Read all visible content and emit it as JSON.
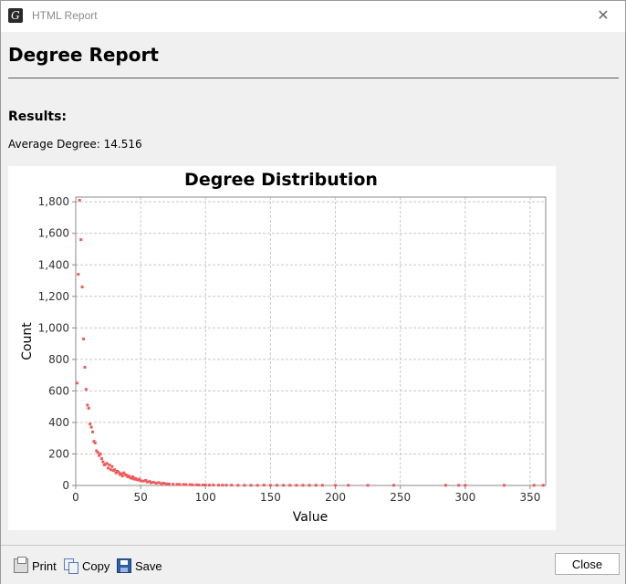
{
  "window": {
    "title": "HTML Report",
    "close_glyph": "✕"
  },
  "report": {
    "title": "Degree Report",
    "results_label": "Results:",
    "average_degree_label": "Average Degree:",
    "average_degree_value": "14.516"
  },
  "toolbar": {
    "print_label": "Print",
    "copy_label": "Copy",
    "save_label": "Save",
    "close_label": "Close"
  },
  "colors": {
    "point": "#f05a5a",
    "grid": "#c8c8c8"
  },
  "chart_data": {
    "type": "scatter",
    "title": "Degree Distribution",
    "xlabel": "Value",
    "ylabel": "Count",
    "xlim": [
      0,
      362
    ],
    "ylim": [
      0,
      1830
    ],
    "x_ticks": [
      0,
      50,
      100,
      150,
      200,
      250,
      300,
      350
    ],
    "y_ticks": [
      0,
      200,
      400,
      600,
      800,
      1000,
      1200,
      1400,
      1600,
      1800
    ],
    "y_tick_labels": [
      "0",
      "200",
      "400",
      "600",
      "800",
      "1,000",
      "1,200",
      "1,400",
      "1,600",
      "1,800"
    ],
    "grid": true,
    "legend": "none",
    "points": [
      [
        1,
        650
      ],
      [
        2,
        1340
      ],
      [
        3,
        1810
      ],
      [
        4,
        1560
      ],
      [
        5,
        1260
      ],
      [
        6,
        930
      ],
      [
        7,
        750
      ],
      [
        8,
        610
      ],
      [
        9,
        510
      ],
      [
        10,
        490
      ],
      [
        11,
        390
      ],
      [
        12,
        370
      ],
      [
        13,
        340
      ],
      [
        14,
        280
      ],
      [
        15,
        270
      ],
      [
        16,
        220
      ],
      [
        17,
        210
      ],
      [
        18,
        190
      ],
      [
        19,
        200
      ],
      [
        20,
        170
      ],
      [
        21,
        150
      ],
      [
        22,
        130
      ],
      [
        23,
        135
      ],
      [
        24,
        140
      ],
      [
        25,
        110
      ],
      [
        26,
        130
      ],
      [
        27,
        100
      ],
      [
        28,
        120
      ],
      [
        29,
        95
      ],
      [
        30,
        100
      ],
      [
        31,
        80
      ],
      [
        32,
        90
      ],
      [
        33,
        85
      ],
      [
        34,
        70
      ],
      [
        35,
        75
      ],
      [
        36,
        60
      ],
      [
        37,
        80
      ],
      [
        38,
        70
      ],
      [
        39,
        65
      ],
      [
        40,
        55
      ],
      [
        41,
        60
      ],
      [
        42,
        50
      ],
      [
        43,
        45
      ],
      [
        44,
        55
      ],
      [
        45,
        40
      ],
      [
        46,
        45
      ],
      [
        47,
        38
      ],
      [
        48,
        35
      ],
      [
        49,
        40
      ],
      [
        50,
        30
      ],
      [
        52,
        28
      ],
      [
        54,
        32
      ],
      [
        55,
        22
      ],
      [
        57,
        25
      ],
      [
        58,
        18
      ],
      [
        60,
        20
      ],
      [
        62,
        15
      ],
      [
        64,
        18
      ],
      [
        66,
        12
      ],
      [
        68,
        14
      ],
      [
        70,
        10
      ],
      [
        72,
        9
      ],
      [
        75,
        8
      ],
      [
        78,
        7
      ],
      [
        80,
        6
      ],
      [
        83,
        6
      ],
      [
        85,
        5
      ],
      [
        88,
        5
      ],
      [
        90,
        4
      ],
      [
        93,
        4
      ],
      [
        95,
        3
      ],
      [
        98,
        3
      ],
      [
        100,
        3
      ],
      [
        103,
        2
      ],
      [
        106,
        3
      ],
      [
        110,
        2
      ],
      [
        113,
        2
      ],
      [
        116,
        2
      ],
      [
        120,
        2
      ],
      [
        125,
        1
      ],
      [
        130,
        1
      ],
      [
        135,
        1
      ],
      [
        140,
        1
      ],
      [
        145,
        2
      ],
      [
        150,
        1
      ],
      [
        155,
        1
      ],
      [
        160,
        1
      ],
      [
        165,
        1
      ],
      [
        170,
        1
      ],
      [
        175,
        1
      ],
      [
        180,
        1
      ],
      [
        185,
        1
      ],
      [
        190,
        1
      ],
      [
        200,
        1
      ],
      [
        210,
        1
      ],
      [
        225,
        1
      ],
      [
        245,
        1
      ],
      [
        285,
        1
      ],
      [
        295,
        1
      ],
      [
        300,
        1
      ],
      [
        330,
        1
      ],
      [
        353,
        1
      ],
      [
        360,
        1
      ]
    ]
  }
}
